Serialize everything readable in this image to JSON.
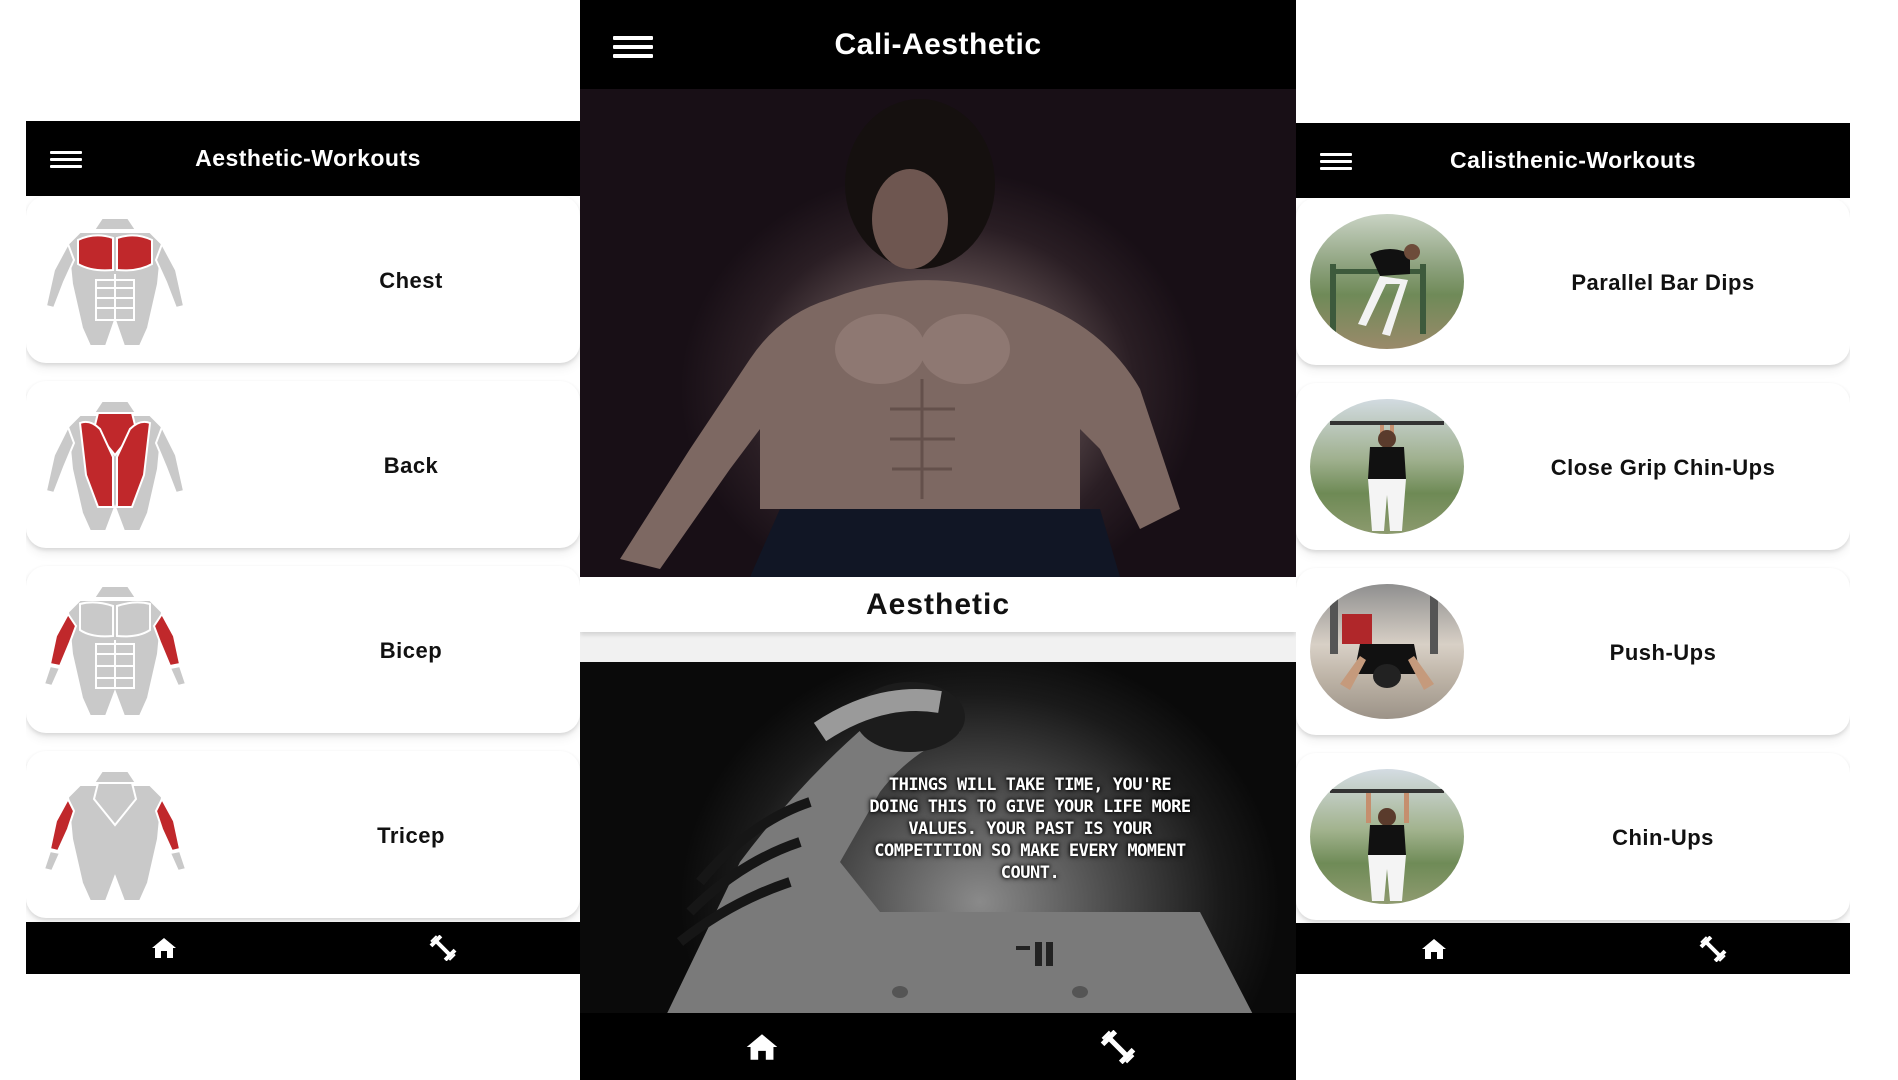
{
  "left": {
    "title": "Aesthetic-Workouts",
    "items": [
      {
        "label": "Chest",
        "muscle": "chest"
      },
      {
        "label": "Back",
        "muscle": "back"
      },
      {
        "label": "Bicep",
        "muscle": "bicep"
      },
      {
        "label": "Tricep",
        "muscle": "tricep"
      }
    ],
    "nav": [
      "home-icon",
      "workout-icon"
    ]
  },
  "center": {
    "title": "Cali-Aesthetic",
    "hero_caption": "Aesthetic",
    "quote": "Things will take time, you're doing this to give your life more values. Your past is your competition so make every moment count.",
    "nav": [
      "home-icon",
      "workout-icon"
    ]
  },
  "right": {
    "title": "Calisthenic-Workouts",
    "items": [
      {
        "label": "Parallel Bar Dips"
      },
      {
        "label": "Close Grip Chin-Ups"
      },
      {
        "label": "Push-Ups"
      },
      {
        "label": "Chin-Ups"
      }
    ],
    "nav": [
      "home-icon",
      "workout-icon"
    ]
  },
  "colors": {
    "bar": "#000000",
    "muscle_highlight": "#c0282b",
    "muscle_base": "#c9c9c9"
  }
}
